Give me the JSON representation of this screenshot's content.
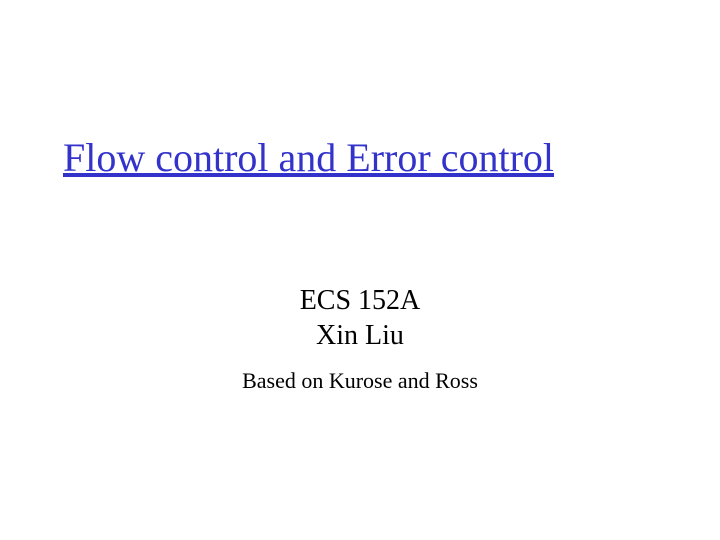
{
  "slide": {
    "title": "Flow control and Error control",
    "course": "ECS 152A",
    "author": "Xin Liu",
    "subtitle": "Based on Kurose and Ross"
  }
}
